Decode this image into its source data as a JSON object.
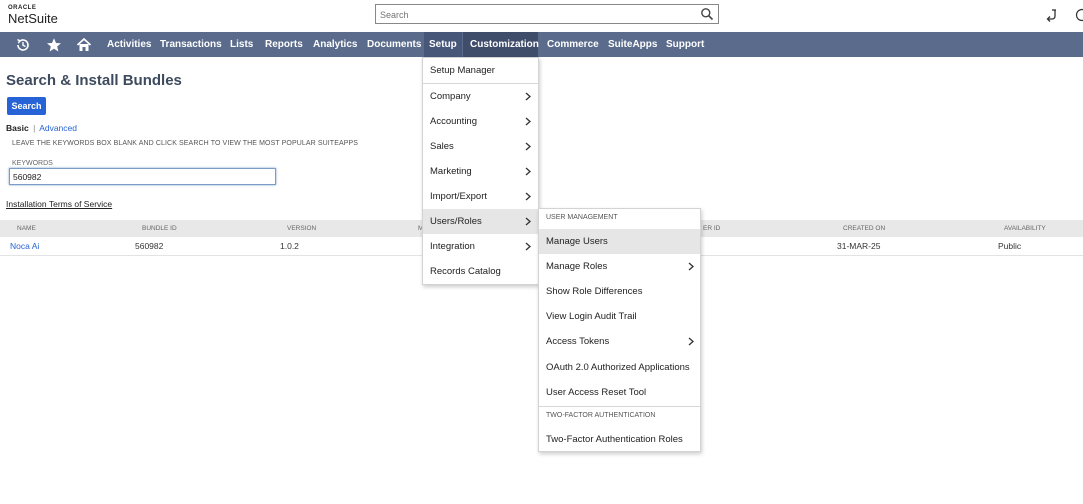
{
  "app": {
    "logo_top": "ORACLE",
    "logo_main": "NetSuite",
    "search_placeholder": "Search"
  },
  "icons": {
    "search": "magnifier-icon",
    "reminder": "reminder-return-icon",
    "help": "help-icon",
    "recent": "recent-records-icon",
    "favorites": "star-icon",
    "home": "home-icon",
    "chevron": "chevron-right-icon"
  },
  "nav": {
    "activities": "Activities",
    "transactions": "Transactions",
    "lists": "Lists",
    "reports": "Reports",
    "analytics": "Analytics",
    "documents": "Documents",
    "setup": "Setup",
    "customization": "Customization",
    "commerce": "Commerce",
    "suiteapps": "SuiteApps",
    "support": "Support"
  },
  "page": {
    "title": "Search & Install Bundles",
    "search_button": "Search",
    "mode_basic": "Basic",
    "mode_sep": "|",
    "mode_advanced": "Advanced",
    "hint": "LEAVE THE KEYWORDS BOX BLANK AND CLICK SEARCH TO VIEW THE MOST POPULAR SUITEAPPS",
    "keywords_label": "KEYWORDS",
    "keywords_value": "560982",
    "terms_link": "Installation Terms of Service"
  },
  "table": {
    "columns": {
      "name": "NAME",
      "bundle_id": "BUNDLE ID",
      "version": "VERSION",
      "partial_m": "M",
      "partial_owner_id": "ER ID",
      "created_on": "CREATED ON",
      "availability": "AVAILABILITY"
    },
    "row": {
      "name": "Noca Ai",
      "bundle_id": "560982",
      "version": "1.0.2",
      "created_on": "31-MAR-25",
      "availability": "Public"
    }
  },
  "setup_menu": {
    "setup_manager": "Setup Manager",
    "company": "Company",
    "accounting": "Accounting",
    "sales": "Sales",
    "marketing": "Marketing",
    "import_export": "Import/Export",
    "users_roles": "Users/Roles",
    "integration": "Integration",
    "records_catalog": "Records Catalog"
  },
  "users_menu": {
    "user_management_header": "USER MANAGEMENT",
    "manage_users": "Manage Users",
    "manage_roles": "Manage Roles",
    "show_role_differences": "Show Role Differences",
    "view_login_audit_trail": "View Login Audit Trail",
    "access_tokens": "Access Tokens",
    "oauth_apps": "OAuth 2.0 Authorized Applications",
    "user_access_reset_tool": "User Access Reset Tool",
    "two_factor_header": "TWO-FACTOR AUTHENTICATION",
    "two_factor_roles": "Two-Factor Authentication Roles"
  },
  "colors": {
    "navbar": "#5a6b8c",
    "nav_active": "#3f4d6b",
    "link": "#2563d6",
    "title": "#3e4b5e"
  }
}
